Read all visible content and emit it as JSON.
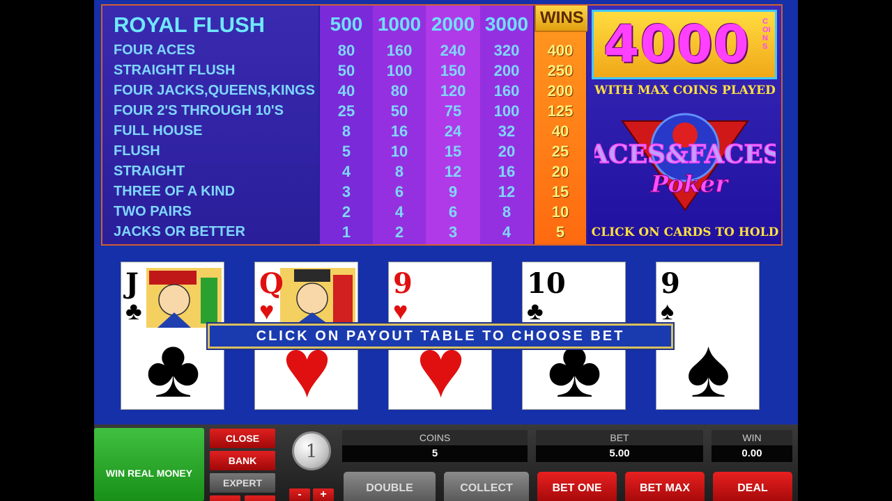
{
  "paytable": {
    "bet_columns": [
      "500",
      "1000",
      "2000",
      "3000"
    ],
    "wins_label": "WINS",
    "top_hand": "ROYAL FLUSH",
    "rows": [
      {
        "hand": "FOUR ACES",
        "pays": [
          "80",
          "160",
          "240",
          "320"
        ],
        "win": "400"
      },
      {
        "hand": "STRAIGHT FLUSH",
        "pays": [
          "50",
          "100",
          "150",
          "200"
        ],
        "win": "250"
      },
      {
        "hand": "FOUR JACKS,QUEENS,KINGS",
        "pays": [
          "40",
          "80",
          "120",
          "160"
        ],
        "win": "200"
      },
      {
        "hand": "FOUR 2'S THROUGH 10'S",
        "pays": [
          "25",
          "50",
          "75",
          "100"
        ],
        "win": "125"
      },
      {
        "hand": "FULL HOUSE",
        "pays": [
          "8",
          "16",
          "24",
          "32"
        ],
        "win": "40"
      },
      {
        "hand": "FLUSH",
        "pays": [
          "5",
          "10",
          "15",
          "20"
        ],
        "win": "25"
      },
      {
        "hand": "STRAIGHT",
        "pays": [
          "4",
          "8",
          "12",
          "16"
        ],
        "win": "20"
      },
      {
        "hand": "THREE OF A KIND",
        "pays": [
          "3",
          "6",
          "9",
          "12"
        ],
        "win": "15"
      },
      {
        "hand": "TWO PAIRS",
        "pays": [
          "2",
          "4",
          "6",
          "8"
        ],
        "win": "10"
      },
      {
        "hand": "JACKS OR BETTER",
        "pays": [
          "1",
          "2",
          "3",
          "4"
        ],
        "win": "5"
      }
    ]
  },
  "promo": {
    "jackpot": "4000",
    "jackpot_unit": "COINS",
    "max_coins_text": "WITH MAX COINS PLAYED",
    "logo_line1": "ACES&FACES",
    "logo_line2": "Poker",
    "hold_hint": "CLICK ON CARDS TO HOLD"
  },
  "cards": [
    {
      "rank": "J",
      "suit": "♣",
      "color": "#000000",
      "face": true
    },
    {
      "rank": "Q",
      "suit": "♥",
      "color": "#e01010",
      "face": true
    },
    {
      "rank": "9",
      "suit": "♥",
      "color": "#e01010",
      "face": false
    },
    {
      "rank": "10",
      "suit": "♣",
      "color": "#000000",
      "face": false
    },
    {
      "rank": "9",
      "suit": "♠",
      "color": "#000000",
      "face": false
    }
  ],
  "bet_banner": "CLICK ON PAYOUT TABLE TO CHOOSE BET",
  "controls": {
    "win_real_money": "WIN REAL MONEY",
    "close": "CLOSE",
    "bank": "BANK",
    "expert": "EXPERT",
    "coin_value": "1",
    "minus": "-",
    "plus": "+",
    "coins_label": "COINS",
    "coins_value": "5",
    "bet_label": "BET",
    "bet_value": "5.00",
    "win_label": "WIN",
    "win_value": "0.00",
    "double": "DOUBLE",
    "collect": "COLLECT",
    "bet_one": "BET ONE",
    "bet_max": "BET MAX",
    "deal": "DEAL"
  }
}
